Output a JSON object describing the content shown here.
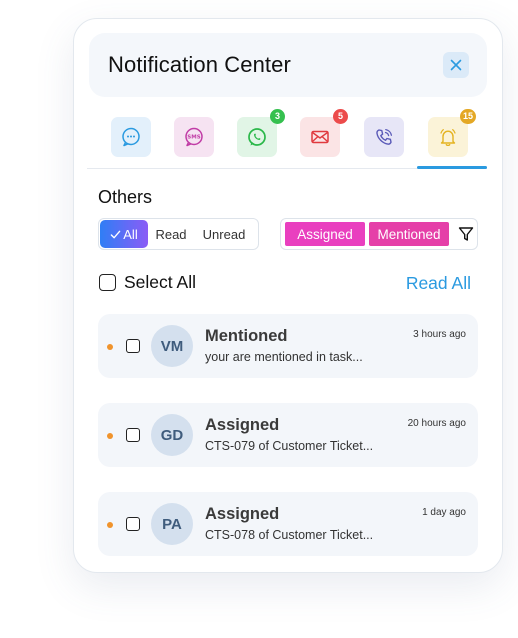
{
  "header": {
    "title": "Notification Center"
  },
  "channels": [
    {
      "name": "chat",
      "icon": "chat-bubble-icon",
      "badge": "",
      "color": "#2a9ae0",
      "bg": "#e3f0fb"
    },
    {
      "name": "sms",
      "icon": "sms-icon",
      "badge": "",
      "color": "#c13ca6",
      "bg": "#f6e3f2"
    },
    {
      "name": "whatsapp",
      "icon": "whatsapp-icon",
      "badge": "3",
      "color": "#2bb84a",
      "bg": "#e1f5e6",
      "badge_color": "#35c04f"
    },
    {
      "name": "email",
      "icon": "email-icon",
      "badge": "5",
      "color": "#e0393e",
      "bg": "#fbe4e5",
      "badge_color": "#ec4b4b"
    },
    {
      "name": "call",
      "icon": "phone-call-icon",
      "badge": "",
      "color": "#5a5ab8",
      "bg": "#e7e6f7"
    },
    {
      "name": "alerts",
      "icon": "bell-icon",
      "badge": "15",
      "color": "#e4b321",
      "bg": "#fbf3d8",
      "badge_color": "#e4a825"
    }
  ],
  "section": {
    "title": "Others"
  },
  "filters": {
    "all": "All",
    "read": "Read",
    "unread": "Unread"
  },
  "tags": {
    "assigned": "Assigned",
    "mentioned": "Mentioned"
  },
  "select_all": "Select All",
  "read_all": "Read All",
  "notifications": [
    {
      "initials": "VM",
      "title": "Mentioned",
      "text": "your are mentioned in task...",
      "time": "3 hours ago"
    },
    {
      "initials": "GD",
      "title": "Assigned",
      "text": "CTS-079 of Customer Ticket...",
      "time": "20 hours ago"
    },
    {
      "initials": "PA",
      "title": "Assigned",
      "text": "CTS-078 of Customer Ticket...",
      "time": "1 day ago"
    }
  ]
}
